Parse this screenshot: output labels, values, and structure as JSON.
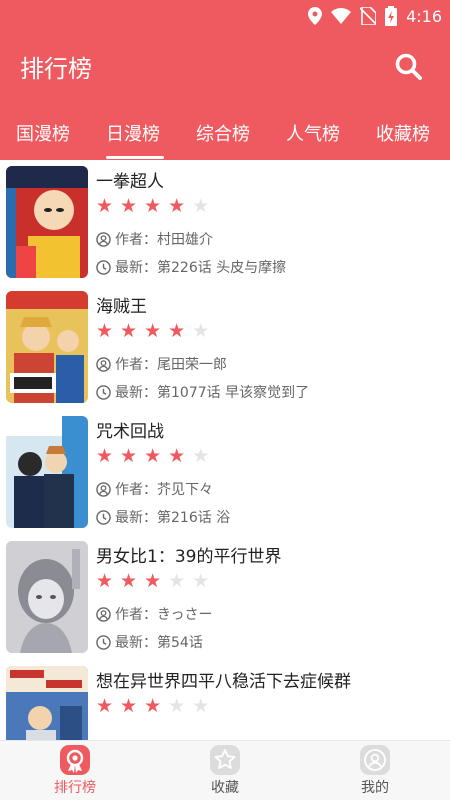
{
  "status_bar": {
    "time": "4:16"
  },
  "header": {
    "title": "排行榜",
    "search_icon": "search-icon"
  },
  "tabs": [
    {
      "label": "国漫榜",
      "active": false
    },
    {
      "label": "日漫榜",
      "active": true
    },
    {
      "label": "综合榜",
      "active": false
    },
    {
      "label": "人气榜",
      "active": false
    },
    {
      "label": "收藏榜",
      "active": false
    }
  ],
  "labels": {
    "author_prefix": "作者：",
    "latest_prefix": "最新："
  },
  "comics": [
    {
      "title": "一拳超人",
      "rating": 4,
      "author": "村田雄介",
      "latest": "第226话 头皮与摩擦"
    },
    {
      "title": "海贼王",
      "rating": 4,
      "author": "尾田荣一郎",
      "latest": "第1077话 早该察觉到了"
    },
    {
      "title": "咒术回战",
      "rating": 4,
      "author": "芥见下々",
      "latest": "第216话 浴"
    },
    {
      "title": "男女比1：39的平行世界",
      "rating": 3,
      "author": "きっさー",
      "latest": "第54话"
    },
    {
      "title": "想在异世界四平八稳活下去症候群",
      "rating": 3,
      "author": "",
      "latest": ""
    }
  ],
  "bottom_nav": [
    {
      "label": "排行榜",
      "icon": "ranking-icon",
      "active": true
    },
    {
      "label": "收藏",
      "icon": "star-icon",
      "active": false
    },
    {
      "label": "我的",
      "icon": "user-icon",
      "active": false
    }
  ],
  "colors": {
    "accent": "#ee5a5f",
    "text": "#222222",
    "muted": "#666666",
    "inactive": "#666666"
  }
}
